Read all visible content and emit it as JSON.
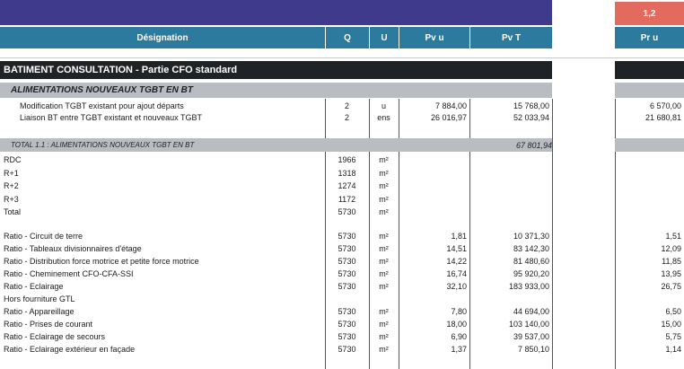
{
  "header": {
    "col_designation": "Désignation",
    "col_q": "Q",
    "col_u": "U",
    "col_pvu": "Pv u",
    "col_pvt": "Pv T",
    "col_pru": "Pr u",
    "coef": "1,2"
  },
  "section": {
    "title": "BATIMENT CONSULTATION - Partie CFO standard",
    "subtitle": "ALIMENTATIONS NOUVEAUX TGBT EN BT",
    "total_label": "TOTAL 1.1 : ALIMENTATIONS NOUVEAUX TGBT EN BT",
    "total_value": "67 801,94"
  },
  "items": [
    {
      "des": "Modification TGBT existant pour ajout départs",
      "q": "2",
      "u": "u",
      "pvu": "7 884,00",
      "pvt": "15 768,00",
      "pru": "6 570,00"
    },
    {
      "des": "Liaison BT entre TGBT existant et nouveaux TGBT",
      "q": "2",
      "u": "ens",
      "pvu": "26 016,97",
      "pvt": "52 033,94",
      "pru": "21 680,81"
    }
  ],
  "surfaces": [
    {
      "des": "RDC",
      "q": "1966",
      "u": "m²"
    },
    {
      "des": "R+1",
      "q": "1318",
      "u": "m²"
    },
    {
      "des": "R+2",
      "q": "1274",
      "u": "m²"
    },
    {
      "des": "R+3",
      "q": "1172",
      "u": "m²"
    },
    {
      "des": "Total",
      "q": "5730",
      "u": "m²"
    }
  ],
  "ratios": [
    {
      "des": "Ratio - Circuit de terre",
      "q": "5730",
      "u": "m²",
      "pvu": "1,81",
      "pvt": "10 371,30",
      "pru": "1,51"
    },
    {
      "des": "Ratio - Tableaux divisionnaires d'étage",
      "q": "5730",
      "u": "m²",
      "pvu": "14,51",
      "pvt": "83 142,30",
      "pru": "12,09"
    },
    {
      "des": "Ratio - Distribution force motrice et petite force motrice",
      "q": "5730",
      "u": "m²",
      "pvu": "14,22",
      "pvt": "81 480,60",
      "pru": "11,85"
    },
    {
      "des": "Ratio - Cheminement CFO-CFA-SSI",
      "q": "5730",
      "u": "m²",
      "pvu": "16,74",
      "pvt": "95 920,20",
      "pru": "13,95"
    },
    {
      "des": "Ratio - Eclairage",
      "q": "5730",
      "u": "m²",
      "pvu": "32,10",
      "pvt": "183 933,00",
      "pru": "26,75"
    },
    {
      "des": "Hors fourniture GTL",
      "q": "",
      "u": "",
      "pvu": "",
      "pvt": "",
      "pru": ""
    },
    {
      "des": "Ratio - Appareillage",
      "q": "5730",
      "u": "m²",
      "pvu": "7,80",
      "pvt": "44 694,00",
      "pru": "6,50"
    },
    {
      "des": "Ratio - Prises de courant",
      "q": "5730",
      "u": "m²",
      "pvu": "18,00",
      "pvt": "103 140,00",
      "pru": "15,00"
    },
    {
      "des": "Ratio - Eclairage de secours",
      "q": "5730",
      "u": "m²",
      "pvu": "6,90",
      "pvt": "39 537,00",
      "pru": "5,75"
    },
    {
      "des": "Ratio - Eclairage extérieur en façade",
      "q": "5730",
      "u": "m²",
      "pvu": "1,37",
      "pvt": "7 850,10",
      "pru": "1,14"
    }
  ]
}
